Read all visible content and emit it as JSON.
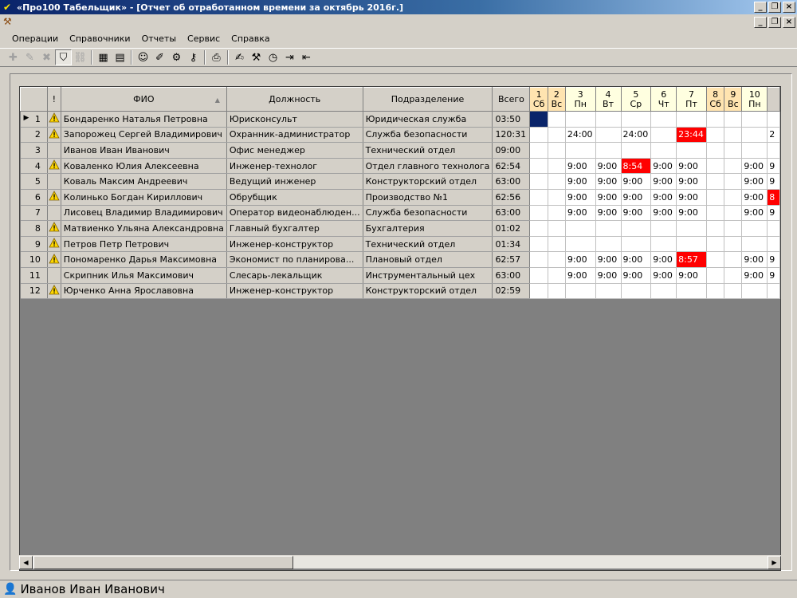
{
  "window": {
    "title": "«Про100 Табельщик» - [Отчет об отработанном времени за октябрь 2016г.]"
  },
  "menu": [
    "Операции",
    "Справочники",
    "Отчеты",
    "Сервис",
    "Справка"
  ],
  "toolbar": [
    {
      "icon": "add-icon",
      "glyph": "✚",
      "disabled": true
    },
    {
      "icon": "edit-icon",
      "glyph": "✎",
      "disabled": true
    },
    {
      "icon": "delete-icon",
      "glyph": "✖",
      "disabled": true
    },
    {
      "icon": "filter-icon",
      "glyph": "⛉",
      "active": true
    },
    {
      "icon": "link-icon",
      "glyph": "⛓",
      "disabled": true
    },
    {
      "sep": true
    },
    {
      "icon": "excel-icon",
      "glyph": "▦"
    },
    {
      "icon": "report-icon",
      "glyph": "▤"
    },
    {
      "sep": true
    },
    {
      "icon": "users-icon",
      "glyph": "☺"
    },
    {
      "icon": "brush-icon",
      "glyph": "✐"
    },
    {
      "icon": "tools-icon",
      "glyph": "⚙"
    },
    {
      "icon": "key-icon",
      "glyph": "⚷"
    },
    {
      "sep": true
    },
    {
      "icon": "print-preview-icon",
      "glyph": "⎙"
    },
    {
      "sep": true
    },
    {
      "icon": "edit-list-icon",
      "glyph": "✍"
    },
    {
      "icon": "hammer-icon",
      "glyph": "⚒"
    },
    {
      "icon": "clock-icon",
      "glyph": "◷"
    },
    {
      "icon": "import-icon",
      "glyph": "⇥"
    },
    {
      "icon": "export-icon",
      "glyph": "⇤"
    }
  ],
  "table": {
    "headers": {
      "warn": "!",
      "fio": "ФИО",
      "position": "Должность",
      "department": "Подразделение",
      "total": "Всего"
    },
    "days": [
      {
        "n": "1",
        "wd": "Сб",
        "weekend": true
      },
      {
        "n": "2",
        "wd": "Вс",
        "weekend": true
      },
      {
        "n": "3",
        "wd": "Пн"
      },
      {
        "n": "4",
        "wd": "Вт"
      },
      {
        "n": "5",
        "wd": "Ср"
      },
      {
        "n": "6",
        "wd": "Чт"
      },
      {
        "n": "7",
        "wd": "Пт"
      },
      {
        "n": "8",
        "wd": "Сб",
        "weekend": true
      },
      {
        "n": "9",
        "wd": "Вс",
        "weekend": true
      },
      {
        "n": "10",
        "wd": "Пн"
      }
    ],
    "rows": [
      {
        "n": "1",
        "warn": true,
        "fio": "Бондаренко Наталья Петровна",
        "position": "Юрисконсульт",
        "department": "Юридическая служба",
        "total": "03:50",
        "cells": [
          "",
          "",
          "",
          "",
          "",
          "",
          "",
          "",
          "",
          "",
          ""
        ],
        "red": [],
        "selected": [
          0
        ],
        "current": true
      },
      {
        "n": "2",
        "warn": true,
        "fio": "Запорожец Сергей Владимирович",
        "position": "Охранник-администратор",
        "department": "Служба безопасности",
        "total": "120:31",
        "cells": [
          "",
          "",
          "24:00",
          "",
          "24:00",
          "",
          "23:44",
          "",
          "",
          "",
          "2"
        ],
        "red": [
          6
        ]
      },
      {
        "n": "3",
        "warn": false,
        "fio": "Иванов Иван Иванович",
        "position": "Офис менеджер",
        "department": "Технический отдел",
        "total": "09:00",
        "cells": [
          "",
          "",
          "",
          "",
          "",
          "",
          "",
          "",
          "",
          "",
          ""
        ],
        "red": []
      },
      {
        "n": "4",
        "warn": true,
        "fio": "Коваленко Юлия Алексеевна",
        "position": "Инженер-технолог",
        "department": "Отдел главного технолога",
        "total": "62:54",
        "cells": [
          "",
          "",
          "9:00",
          "9:00",
          "8:54",
          "9:00",
          "9:00",
          "",
          "",
          "9:00",
          "9"
        ],
        "red": [
          4
        ]
      },
      {
        "n": "5",
        "warn": false,
        "fio": "Коваль Максим Андреевич",
        "position": "Ведущий инженер",
        "department": "Конструкторский отдел",
        "total": "63:00",
        "cells": [
          "",
          "",
          "9:00",
          "9:00",
          "9:00",
          "9:00",
          "9:00",
          "",
          "",
          "9:00",
          "9"
        ],
        "red": []
      },
      {
        "n": "6",
        "warn": true,
        "fio": "Колинько Богдан Кириллович",
        "position": "Обрубщик",
        "department": "Производство №1",
        "total": "62:56",
        "cells": [
          "",
          "",
          "9:00",
          "9:00",
          "9:00",
          "9:00",
          "9:00",
          "",
          "",
          "9:00",
          "8"
        ],
        "red": [
          10
        ]
      },
      {
        "n": "7",
        "warn": false,
        "fio": "Лисовец Владимир Владимирович",
        "position": "Оператор видеонаблюден...",
        "department": "Служба безопасности",
        "total": "63:00",
        "cells": [
          "",
          "",
          "9:00",
          "9:00",
          "9:00",
          "9:00",
          "9:00",
          "",
          "",
          "9:00",
          "9"
        ],
        "red": []
      },
      {
        "n": "8",
        "warn": true,
        "fio": "Матвиенко Ульяна Александровна",
        "position": "Главный бухгалтер",
        "department": "Бухгалтерия",
        "total": "01:02",
        "cells": [
          "",
          "",
          "",
          "",
          "",
          "",
          "",
          "",
          "",
          "",
          ""
        ],
        "red": []
      },
      {
        "n": "9",
        "warn": true,
        "fio": "Петров Петр Петрович",
        "position": "Инженер-конструктор",
        "department": "Технический отдел",
        "total": "01:34",
        "cells": [
          "",
          "",
          "",
          "",
          "",
          "",
          "",
          "",
          "",
          "",
          ""
        ],
        "red": []
      },
      {
        "n": "10",
        "warn": true,
        "fio": "Пономаренко Дарья Максимовна",
        "position": "Экономист по планирова...",
        "department": "Плановый отдел",
        "total": "62:57",
        "cells": [
          "",
          "",
          "9:00",
          "9:00",
          "9:00",
          "9:00",
          "8:57",
          "",
          "",
          "9:00",
          "9"
        ],
        "red": [
          6
        ]
      },
      {
        "n": "11",
        "warn": false,
        "fio": "Скрипник Илья Максимович",
        "position": "Слесарь-лекальщик",
        "department": "Инструментальный цех",
        "total": "63:00",
        "cells": [
          "",
          "",
          "9:00",
          "9:00",
          "9:00",
          "9:00",
          "9:00",
          "",
          "",
          "9:00",
          "9"
        ],
        "red": []
      },
      {
        "n": "12",
        "warn": true,
        "fio": "Юрченко Анна Ярославовна",
        "position": "Инженер-конструктор",
        "department": "Конструкторский отдел",
        "total": "02:59",
        "cells": [
          "",
          "",
          "",
          "",
          "",
          "",
          "",
          "",
          "",
          "",
          ""
        ],
        "red": []
      }
    ]
  },
  "status": {
    "user": "Иванов Иван Иванович"
  },
  "colors": {
    "title_start": "#0a246a",
    "title_end": "#a6caf0",
    "red_cell": "#ff0000",
    "selection": "#0a246a",
    "weekend_header": "#ffe4b0",
    "warning": "#ffd700"
  }
}
